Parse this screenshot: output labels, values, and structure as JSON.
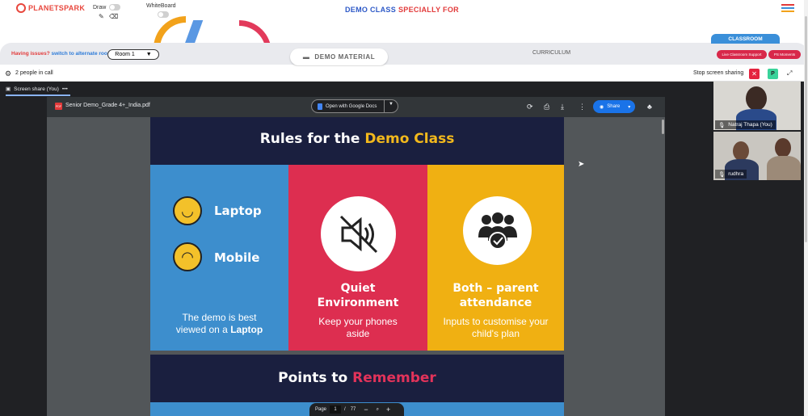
{
  "header": {
    "brand": "PLANETSPARK",
    "draw_label": "Draw",
    "whiteboard_label": "WhiteBoard",
    "title_part1": "DEMO CLASS",
    "title_part2": "SPECIALLY FOR",
    "colors": {
      "brand": "#e8473d",
      "title_blue": "#2d59c7",
      "title_red": "#e23a3a"
    }
  },
  "roombar": {
    "issue_text": "Having issues?",
    "issue_link": "switch to alternate room",
    "room_select": "Room 1",
    "demo_material": "DEMO MATERIAL",
    "curriculum": "CURRICULUM",
    "classroom_tab": "CLASSROOM",
    "live_support": "Live Classroom Support",
    "ps_moments": "PS Moments"
  },
  "callbar": {
    "people": "2 people in call",
    "stop_sharing": "Stop screen sharing",
    "p_badge": "P"
  },
  "screen_share": {
    "tab_label": "Screen share (You)"
  },
  "pdf": {
    "icon_text": "PDF",
    "filename": "Senior Demo_Grade 4+_India.pdf",
    "open_with": "Open with Google Docs",
    "share": "Share",
    "page_label": "Page",
    "page_current": "1",
    "page_sep": "/",
    "page_total": "77"
  },
  "slide1": {
    "title_white": "Rules for the",
    "title_yellow": "Demo Class",
    "laptop": "Laptop",
    "mobile": "Mobile",
    "col1_body_1": "The demo is best",
    "col1_body_2a": "viewed on a ",
    "col1_body_2b": "Laptop",
    "col2_head_1": "Quiet",
    "col2_head_2": "Environment",
    "col2_body_1": "Keep your phones",
    "col2_body_2": "aside",
    "col3_head_1": "Both – parent",
    "col3_head_2": "attendance",
    "col3_body_1": "Inputs to customise your",
    "col3_body_2": "child's plan",
    "colors": {
      "blue": "#3d8ecd",
      "red": "#dd2e50",
      "yellow": "#f0b012",
      "navy": "#1a1f3f"
    }
  },
  "slide2": {
    "title_white": "Points to",
    "title_red": "Remember"
  },
  "participants": [
    {
      "name": "Natraj Thapa (You)"
    },
    {
      "name": "rudhra"
    }
  ]
}
